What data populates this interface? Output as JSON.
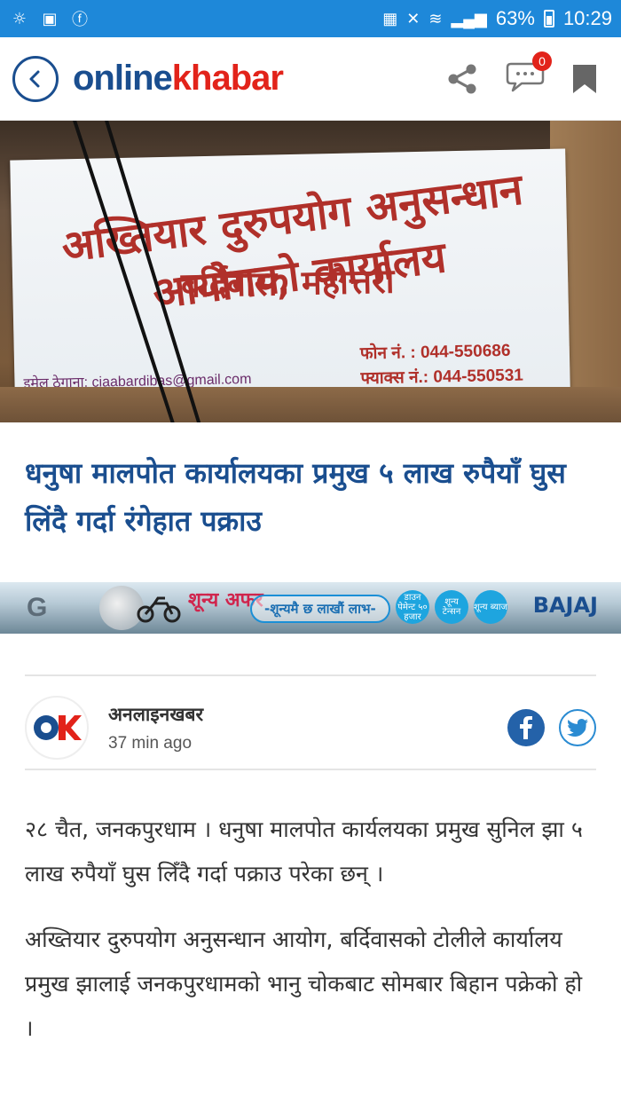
{
  "status_bar": {
    "battery": "63%",
    "time": "10:29"
  },
  "app_bar": {
    "logo_part1": "online",
    "logo_part2": "khabar",
    "comment_count": "0"
  },
  "hero_image": {
    "sign_line1": "अख्तियार दुरुपयोग अनुसन्धान आयोगको कार्यालय",
    "sign_line2": "बर्दिवास, महोत्तरी",
    "sign_phone": "फोन नं. : 044-550686",
    "sign_fax": "फ्याक्स नं.: 044-550531",
    "sign_email": "इमेल ठेगाना: ciaabardibas@gmail.com"
  },
  "article": {
    "headline": "धनुषा मालपोत कार्यालयका प्रमुख ५ लाख रुपैयाँ घुस लिंदै गर्दा रंगेहात पक्राउ",
    "author_name": "अनलाइनखबर",
    "published": "37 min ago",
    "paragraphs": [
      "२८ चैत, जनकपुरधाम । धनुषा मालपोत कार्यलयका प्रमुख सुनिल झा ५ लाख रुपैयाँ घुस लिँदै गर्दा पक्राउ परेका छन् ।",
      "अख्तियार दुरुपयोग अनुसन्धान आयोग, बर्दिवासको टोलीले कार्यालय प्रमुख झालाई जनकपुरधामको भानु चोकबाट सोमबार बिहान पक्रेको हो ।"
    ]
  },
  "ad_banner": {
    "left_mark": "G",
    "brand_text": "शून्य अफर",
    "tagline": "-शून्यमै छ लाखौं लाभ-",
    "bubble1": "डाउन पेमेन्ट ५० हजार",
    "bubble2": "शून्य टेन्सन",
    "bubble3": "शून्य ब्याज",
    "right_brand": "BAJAJ"
  },
  "colors": {
    "status_bar": "#1e88d9",
    "brand_blue": "#1a4e8f",
    "brand_red": "#e2231a",
    "facebook": "#2462a9",
    "twitter": "#2a8bd2"
  }
}
